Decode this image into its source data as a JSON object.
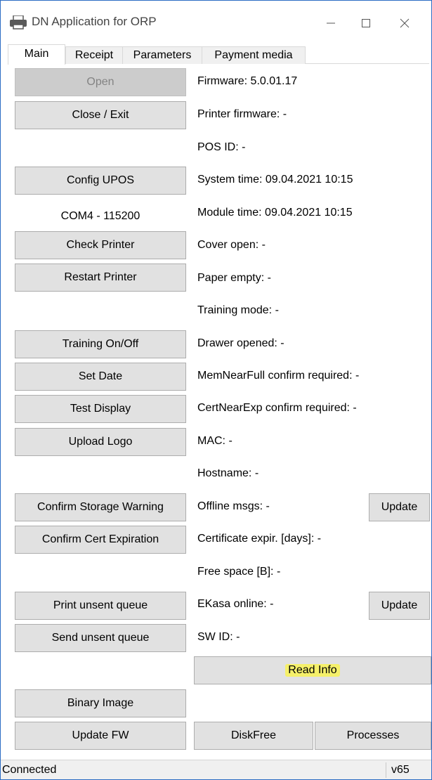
{
  "window": {
    "title": "DN Application for ORP",
    "icon": "printer-icon"
  },
  "tabs": [
    {
      "label": "Main",
      "active": true
    },
    {
      "label": "Receipt",
      "active": false
    },
    {
      "label": "Parameters",
      "active": false
    },
    {
      "label": "Payment media",
      "active": false
    }
  ],
  "buttons": {
    "open": "Open",
    "close_exit": "Close / Exit",
    "config_upos": "Config UPOS",
    "check_printer": "Check Printer",
    "restart_printer": "Restart Printer",
    "training": "Training On/Off",
    "set_date": "Set Date",
    "test_display": "Test Display",
    "upload_logo": "Upload Logo",
    "confirm_storage": "Confirm Storage Warning",
    "confirm_cert": "Confirm Cert Expiration",
    "print_unsent": "Print unsent queue",
    "send_unsent": "Send unsent queue",
    "binary_image": "Binary Image",
    "update_fw": "Update FW",
    "update_offline": "Update",
    "update_ekasa": "Update",
    "read_info": "Read Info",
    "diskfree": "DiskFree",
    "processes": "Processes"
  },
  "com_port": "COM4 - 115200",
  "info": {
    "firmware": "Firmware: 5.0.01.17",
    "printer_firmware": "Printer firmware: -",
    "pos_id": "POS ID: -",
    "system_time": "System time: 09.04.2021 10:15",
    "module_time": "Module time: 09.04.2021 10:15",
    "cover_open": "Cover open: -",
    "paper_empty": "Paper empty: -",
    "training_mode": "Training mode: -",
    "drawer_opened": "Drawer opened: -",
    "memnearfull": "MemNearFull confirm required: -",
    "certnearexp": "CertNearExp confirm required: -",
    "mac": "MAC: -",
    "hostname": "Hostname: -",
    "offline_msgs": "Offline msgs: -",
    "cert_expir": "Certificate expir. [days]: -",
    "free_space": "Free space [B]: -",
    "ekasa_online": "EKasa online: -",
    "sw_id": "SW ID: -"
  },
  "status": {
    "text": "Connected",
    "version": "v65"
  },
  "colors": {
    "highlight": "#f5f06a",
    "window_border": "#2b6cc4",
    "button_bg": "#e1e1e1"
  }
}
